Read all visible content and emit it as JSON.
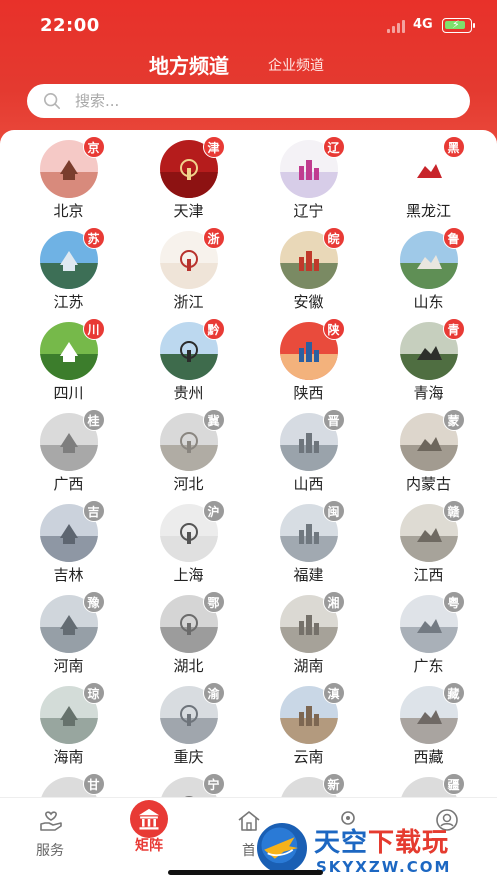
{
  "status_bar": {
    "time": "22:00",
    "network": "4G"
  },
  "channel_tabs": {
    "active": "地方频道",
    "inactive": "企业频道"
  },
  "search": {
    "placeholder": "搜索..."
  },
  "regions": [
    {
      "name": "北京",
      "badge": "京",
      "badge_color": "red",
      "sky": "#f5c9c6",
      "land": "#d88a7c",
      "mark": "#7a3d2d"
    },
    {
      "name": "天津",
      "badge": "津",
      "badge_color": "red",
      "sky": "#b51c1c",
      "land": "#8d1212",
      "mark": "#f0d38a"
    },
    {
      "name": "辽宁",
      "badge": "辽",
      "badge_color": "red",
      "sky": "#f4f2f6",
      "land": "#d7cde8",
      "mark": "#c03c8f"
    },
    {
      "name": "黑龙江",
      "badge": "黑",
      "badge_color": "red",
      "sky": "#ffffff",
      "land": "#ffffff",
      "mark": "#c8242a"
    },
    {
      "name": "江苏",
      "badge": "苏",
      "badge_color": "red",
      "sky": "#6fb2e4",
      "land": "#3d6f56",
      "mark": "#dfe9f1"
    },
    {
      "name": "浙江",
      "badge": "浙",
      "badge_color": "red",
      "sky": "#f7f2ec",
      "land": "#efe4d8",
      "mark": "#b8322d"
    },
    {
      "name": "安徽",
      "badge": "皖",
      "badge_color": "red",
      "sky": "#e9d8b8",
      "land": "#7a8a63",
      "mark": "#c0392b"
    },
    {
      "name": "山东",
      "badge": "鲁",
      "badge_color": "red",
      "sky": "#9fc9e8",
      "land": "#5f8f55",
      "mark": "#e9e6df"
    },
    {
      "name": "四川",
      "badge": "川",
      "badge_color": "red",
      "sky": "#76b94a",
      "land": "#3c7d2c",
      "mark": "#ffffff"
    },
    {
      "name": "贵州",
      "badge": "黔",
      "badge_color": "red",
      "sky": "#bcd8ef",
      "land": "#3e6b4c",
      "mark": "#2b2b2b"
    },
    {
      "name": "陕西",
      "badge": "陕",
      "badge_color": "red",
      "sky": "#e94b3c",
      "land": "#f3b27c",
      "mark": "#2c5fa0"
    },
    {
      "name": "青海",
      "badge": "青",
      "badge_color": "red",
      "sky": "#c6cfbe",
      "land": "#4f6e41",
      "mark": "#2d2f2b"
    },
    {
      "name": "广西",
      "badge": "桂",
      "badge_color": "gray",
      "sky": "#dadada",
      "land": "#a8a8a8",
      "mark": "#7e7e7e"
    },
    {
      "name": "河北",
      "badge": "冀",
      "badge_color": "gray",
      "sky": "#d9d9d9",
      "land": "#b0aca4",
      "mark": "#8a8680"
    },
    {
      "name": "山西",
      "badge": "晋",
      "badge_color": "gray",
      "sky": "#d6dbe2",
      "land": "#9aa3ab",
      "mark": "#6e757c"
    },
    {
      "name": "内蒙古",
      "badge": "蒙",
      "badge_color": "gray",
      "sky": "#ddd6cc",
      "land": "#a29b90",
      "mark": "#6d665c"
    },
    {
      "name": "吉林",
      "badge": "吉",
      "badge_color": "gray",
      "sky": "#cbd2dc",
      "land": "#8e97a4",
      "mark": "#5d6570"
    },
    {
      "name": "上海",
      "badge": "沪",
      "badge_color": "gray",
      "sky": "#ececec",
      "land": "#e0e0e0",
      "mark": "#555555"
    },
    {
      "name": "福建",
      "badge": "闽",
      "badge_color": "gray",
      "sky": "#d7dde3",
      "land": "#a1a9b1",
      "mark": "#70787f"
    },
    {
      "name": "江西",
      "badge": "赣",
      "badge_color": "gray",
      "sky": "#dedbd3",
      "land": "#a7a39a",
      "mark": "#6f6a62"
    },
    {
      "name": "河南",
      "badge": "豫",
      "badge_color": "gray",
      "sky": "#d0d6dc",
      "land": "#969fa7",
      "mark": "#646c73"
    },
    {
      "name": "湖北",
      "badge": "鄂",
      "badge_color": "gray",
      "sky": "#d5d5d5",
      "land": "#9c9c9c",
      "mark": "#6b6b6b"
    },
    {
      "name": "湖南",
      "badge": "湘",
      "badge_color": "gray",
      "sky": "#dbd9d3",
      "land": "#a6a299",
      "mark": "#75716a"
    },
    {
      "name": "广东",
      "badge": "粤",
      "badge_color": "gray",
      "sky": "#dfe3e8",
      "land": "#a9b0b8",
      "mark": "#737a82"
    },
    {
      "name": "海南",
      "badge": "琼",
      "badge_color": "gray",
      "sky": "#d3dcd8",
      "land": "#98a69f",
      "mark": "#66726c"
    },
    {
      "name": "重庆",
      "badge": "渝",
      "badge_color": "gray",
      "sky": "#d8dce0",
      "land": "#a0a6ad",
      "mark": "#6e747b"
    },
    {
      "name": "云南",
      "badge": "滇",
      "badge_color": "gray",
      "sky": "#c9d7e6",
      "land": "#b39a7e",
      "mark": "#7d6752"
    },
    {
      "name": "西藏",
      "badge": "藏",
      "badge_color": "gray",
      "sky": "#dde3e9",
      "land": "#a9a4a0",
      "mark": "#6f6965"
    },
    {
      "name": "",
      "badge": "甘",
      "badge_color": "gray",
      "sky": "#dcdcdc",
      "land": "#aaaaaa",
      "mark": "#777777"
    },
    {
      "name": "",
      "badge": "宁",
      "badge_color": "gray",
      "sky": "#dcdcdc",
      "land": "#aaaaaa",
      "mark": "#777777"
    },
    {
      "name": "",
      "badge": "新",
      "badge_color": "gray",
      "sky": "#dcdcdc",
      "land": "#aaaaaa",
      "mark": "#777777"
    },
    {
      "name": "",
      "badge": "疆",
      "badge_color": "gray",
      "sky": "#dcdcdc",
      "land": "#aaaaaa",
      "mark": "#777777"
    }
  ],
  "tabbar": [
    {
      "label": "服务",
      "icon": "service-hand-icon",
      "active": false
    },
    {
      "label": "矩阵",
      "icon": "matrix-building-icon",
      "active": true
    },
    {
      "label": "首",
      "icon": "home-icon",
      "active": false
    },
    {
      "label": "",
      "icon": "location-icon",
      "active": false
    },
    {
      "label": "",
      "icon": "profile-icon",
      "active": false
    }
  ],
  "watermark": {
    "title_blue": "天空",
    "title_red": "下载玩",
    "domain": "SKYXZW.COM"
  },
  "colors": {
    "brand_red": "#e83a35",
    "badge_gray": "#9a9a9a",
    "text_dark": "#222222"
  }
}
